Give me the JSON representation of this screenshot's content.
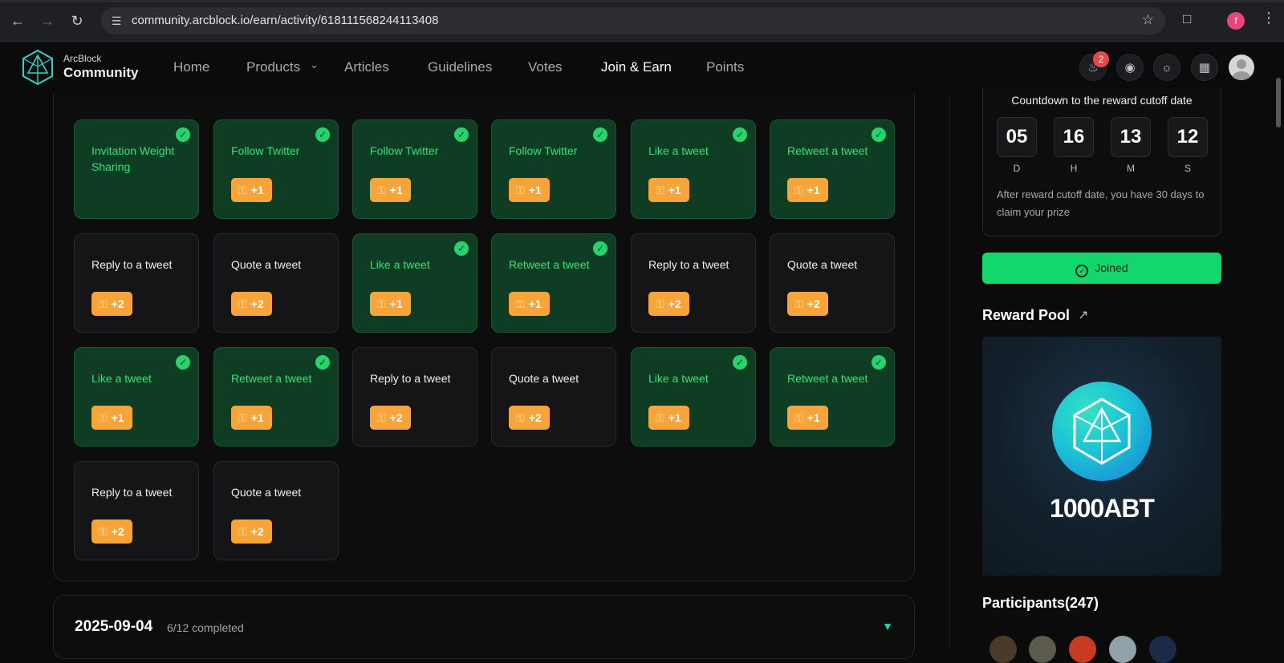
{
  "browser": {
    "url": "community.arcblock.io/earn/activity/618111568244113408",
    "profile_initial": "f"
  },
  "app": {
    "logo_small": "ArcBlock",
    "logo_big": "Community",
    "nav": [
      {
        "label": "Home"
      },
      {
        "label": "Products"
      },
      {
        "label": "Articles"
      },
      {
        "label": "Guidelines"
      },
      {
        "label": "Votes"
      },
      {
        "label": "Join & Earn"
      },
      {
        "label": "Points"
      }
    ],
    "notification_count": "2"
  },
  "tasks": {
    "items": [
      {
        "title": "Invitation Weight Sharing",
        "points": "",
        "done": true
      },
      {
        "title": "Follow Twitter",
        "points": "+1",
        "done": true
      },
      {
        "title": "Follow Twitter",
        "points": "+1",
        "done": true
      },
      {
        "title": "Follow Twitter",
        "points": "+1",
        "done": true
      },
      {
        "title": "Like a tweet",
        "points": "+1",
        "done": true
      },
      {
        "title": "Retweet a tweet",
        "points": "+1",
        "done": true
      },
      {
        "title": "Reply to a tweet",
        "points": "+2",
        "done": false
      },
      {
        "title": "Quote a tweet",
        "points": "+2",
        "done": false
      },
      {
        "title": "Like a tweet",
        "points": "+1",
        "done": true
      },
      {
        "title": "Retweet a tweet",
        "points": "+1",
        "done": true
      },
      {
        "title": "Reply to a tweet",
        "points": "+2",
        "done": false
      },
      {
        "title": "Quote a tweet",
        "points": "+2",
        "done": false
      },
      {
        "title": "Like a tweet",
        "points": "+1",
        "done": true
      },
      {
        "title": "Retweet a tweet",
        "points": "+1",
        "done": true
      },
      {
        "title": "Reply to a tweet",
        "points": "+2",
        "done": false
      },
      {
        "title": "Quote a tweet",
        "points": "+2",
        "done": false
      },
      {
        "title": "Like a tweet",
        "points": "+1",
        "done": true
      },
      {
        "title": "Retweet a tweet",
        "points": "+1",
        "done": true
      },
      {
        "title": "Reply to a tweet",
        "points": "+2",
        "done": false
      },
      {
        "title": "Quote a tweet",
        "points": "+2",
        "done": false
      }
    ]
  },
  "day_row": {
    "date": "2025-09-04",
    "progress": "6/12 completed"
  },
  "countdown": {
    "title": "Countdown to the reward cutoff date",
    "units": [
      {
        "value": "05",
        "label": "D"
      },
      {
        "value": "16",
        "label": "H"
      },
      {
        "value": "13",
        "label": "M"
      },
      {
        "value": "12",
        "label": "S"
      }
    ],
    "note": "After reward cutoff date, you have 30 days to claim your prize"
  },
  "joined_label": "Joined",
  "reward": {
    "title": "Reward Pool",
    "amount": "1000ABT"
  },
  "participants_label": "Participants(247)",
  "colors": {
    "done_card": "#0f3d24",
    "done_text": "#2ee37a",
    "points_pill": "#f7a53a",
    "joined_button": "#11d76c"
  }
}
